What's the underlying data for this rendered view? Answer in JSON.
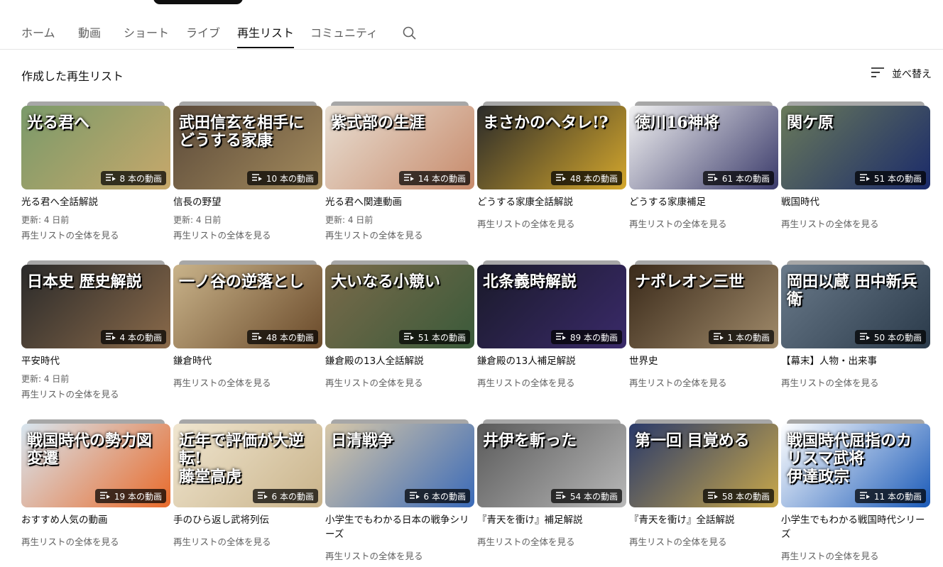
{
  "tabs": [
    {
      "label": "ホーム"
    },
    {
      "label": "動画"
    },
    {
      "label": "ショート"
    },
    {
      "label": "ライブ"
    },
    {
      "label": "再生リスト",
      "active": true
    },
    {
      "label": "コミュニティ"
    }
  ],
  "section": {
    "title": "作成した再生リスト",
    "sort_label": "並べ替え"
  },
  "view_all_label": "再生リストの全体を見る",
  "playlists": [
    {
      "title": "光る君へ全話解説",
      "count": "8 本の動画",
      "updated": "更新: 4 日前",
      "thumb_text": "光る君へ",
      "colors": [
        "#7a9a6a",
        "#c7a86b"
      ]
    },
    {
      "title": "信長の野望",
      "count": "10 本の動画",
      "updated": "更新: 4 日前",
      "thumb_text": "武田信玄を相手にどうする家康",
      "colors": [
        "#5b4a3a",
        "#a38a5c"
      ]
    },
    {
      "title": "光る君へ関連動画",
      "count": "14 本の動画",
      "updated": "更新: 4 日前",
      "thumb_text": "紫式部の生涯",
      "colors": [
        "#e8dfd3",
        "#c78a6b"
      ]
    },
    {
      "title": "どうする家康全話解説",
      "count": "48 本の動画",
      "updated": "",
      "thumb_text": "まさかのヘタレ!?",
      "colors": [
        "#2a2a2a",
        "#d4a72c"
      ]
    },
    {
      "title": "どうする家康補足",
      "count": "61 本の動画",
      "updated": "",
      "thumb_text": "徳川16神将",
      "colors": [
        "#f2f2f2",
        "#3a3a6a"
      ]
    },
    {
      "title": "戦国時代",
      "count": "51 本の動画",
      "updated": "",
      "thumb_text": "関ケ原",
      "colors": [
        "#6a7a5a",
        "#1a2a6a"
      ]
    },
    {
      "title": "平安時代",
      "count": "4 本の動画",
      "updated": "更新: 4 日前",
      "thumb_text": "日本史 歴史解説",
      "colors": [
        "#2a2a2a",
        "#8a6a4a"
      ]
    },
    {
      "title": "鎌倉時代",
      "count": "48 本の動画",
      "updated": "",
      "thumb_text": "一ノ谷の逆落とし",
      "colors": [
        "#c9b38a",
        "#6a4a2a"
      ]
    },
    {
      "title": "鎌倉殿の13人全話解説",
      "count": "51 本の動画",
      "updated": "",
      "thumb_text": "大いなる小競い",
      "colors": [
        "#7a6a4a",
        "#3a5a3a"
      ]
    },
    {
      "title": "鎌倉殿の13人補足解説",
      "count": "89 本の動画",
      "updated": "",
      "thumb_text": "北条義時解説",
      "colors": [
        "#1a1a2a",
        "#3a2a6a"
      ]
    },
    {
      "title": "世界史",
      "count": "1 本の動画",
      "updated": "",
      "thumb_text": "ナポレオン三世",
      "colors": [
        "#3a2a1a",
        "#a08a6a"
      ]
    },
    {
      "title": "【幕末】人物・出来事",
      "count": "50 本の動画",
      "updated": "",
      "thumb_text": "岡田以蔵 田中新兵衛",
      "colors": [
        "#6a7a8a",
        "#2a3a4a"
      ]
    },
    {
      "title": "おすすめ人気の動画",
      "count": "19 本の動画",
      "updated": "",
      "thumb_text": "戦国時代の勢力図変遷",
      "colors": [
        "#d8e6f0",
        "#e86a2a"
      ]
    },
    {
      "title": "手のひら返し武将列伝",
      "count": "6 本の動画",
      "updated": "",
      "thumb_text": "近年で評価が大逆転!\n藤堂高虎",
      "colors": [
        "#f0e6d0",
        "#c9b38a"
      ]
    },
    {
      "title": "小学生でもわかる日本の戦争シリーズ",
      "count": "6 本の動画",
      "updated": "",
      "thumb_text": "日清戦争",
      "colors": [
        "#d8c8a8",
        "#3a6ab8"
      ]
    },
    {
      "title": "『青天を衝け』補足解説",
      "count": "54 本の動画",
      "updated": "",
      "thumb_text": "井伊を斬った",
      "colors": [
        "#5a5a5a",
        "#b8b8b8"
      ]
    },
    {
      "title": "『青天を衝け』全話解説",
      "count": "58 本の動画",
      "updated": "",
      "thumb_text": "第一回 目覚める",
      "colors": [
        "#2a3a6a",
        "#c9a84a"
      ]
    },
    {
      "title": "小学生でもわかる戦国時代シリーズ",
      "count": "11 本の動画",
      "updated": "",
      "thumb_text": "戦国時代屈指のカリスマ武将\n伊達政宗",
      "colors": [
        "#ffffff",
        "#1a5ab8"
      ]
    }
  ]
}
